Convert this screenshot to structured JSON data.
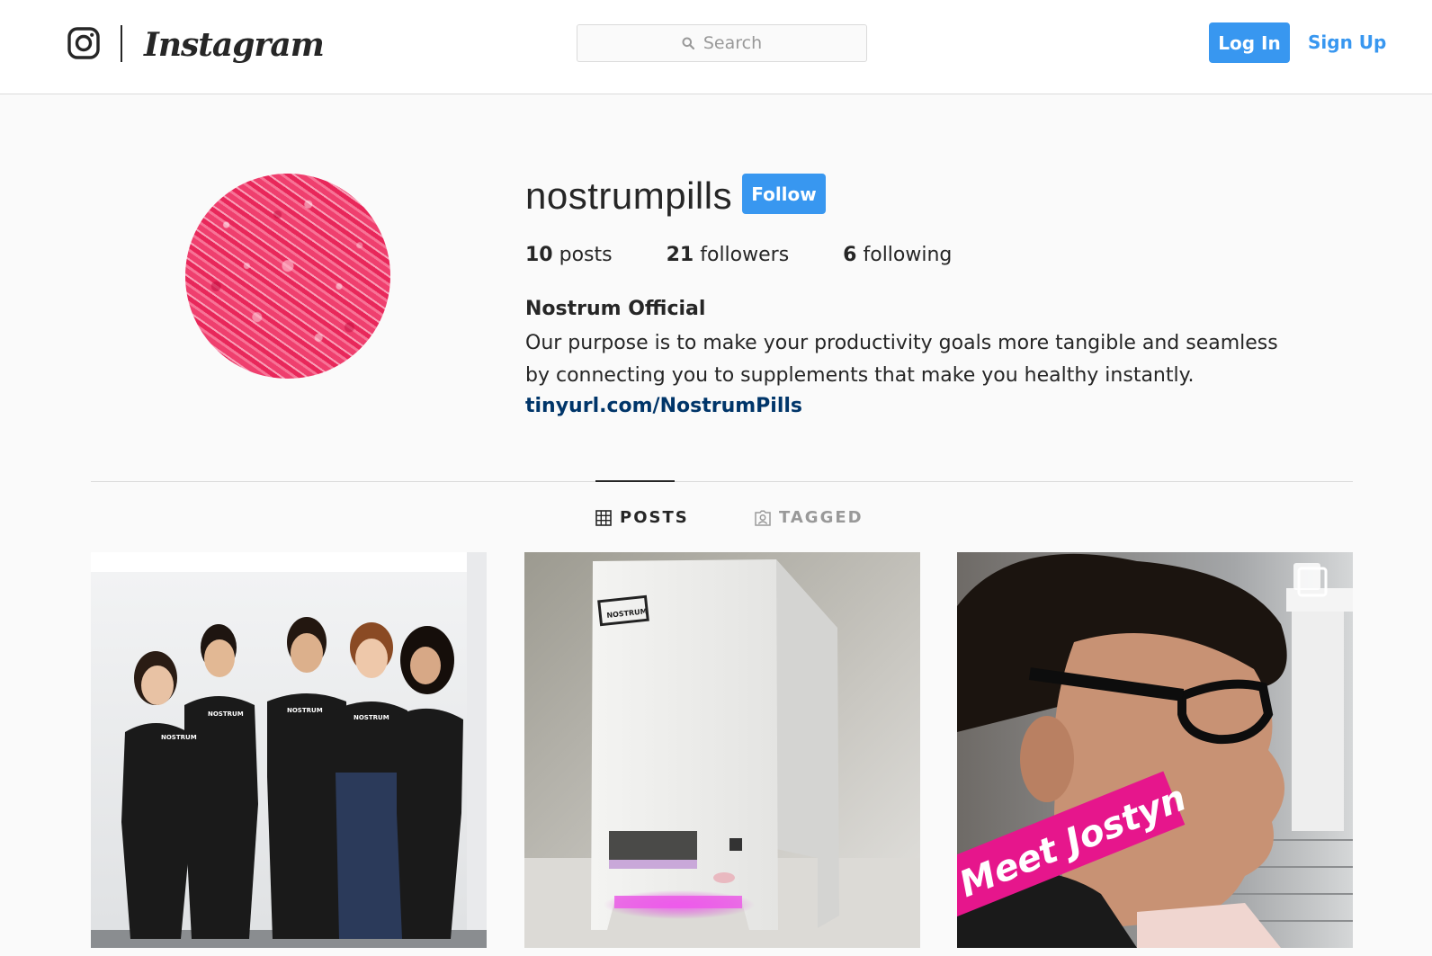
{
  "nav": {
    "brand_name": "Instagram",
    "search_placeholder": "Search",
    "login_label": "Log In",
    "signup_label": "Sign Up"
  },
  "profile": {
    "username": "nostrumpills",
    "follow_label": "Follow",
    "stats": [
      {
        "count": "10",
        "label": "posts"
      },
      {
        "count": "21",
        "label": "followers"
      },
      {
        "count": "6",
        "label": "following"
      }
    ],
    "full_name": "Nostrum Official",
    "bio": "Our purpose is to make your productivity goals more tangible and seamless by connecting you to supplements that make you healthy instantly.",
    "link": "tinyurl.com/NostrumPills"
  },
  "tabs": [
    {
      "label": "POSTS",
      "icon": "grid-icon",
      "active": true
    },
    {
      "label": "TAGGED",
      "icon": "tagged-person-icon",
      "active": false
    }
  ],
  "posts": [
    {
      "alt": "Five team members in black Nostrum t-shirts",
      "shirt_text": "NOSTRUM"
    },
    {
      "alt": "White Nostrum pill dispensing machine with pink glow",
      "machine_label": "NOSTRUM"
    },
    {
      "alt": "Portrait of man with glasses",
      "caption_overlay": "Meet Jostyn",
      "multi_image": true
    }
  ],
  "colors": {
    "accent": "#3897f0",
    "link": "#003569",
    "avatar_pink": "#ec3a68",
    "overlay_magenta": "#e6168c"
  }
}
